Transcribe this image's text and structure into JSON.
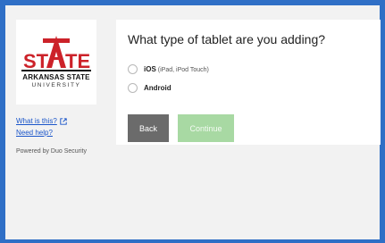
{
  "sidebar": {
    "logo": {
      "mark_text": "STATE",
      "line1": "ARKANSAS STATE",
      "line2": "UNIVERSITY",
      "colors": {
        "red": "#cc2229",
        "black": "#111111"
      }
    },
    "links": [
      {
        "label": "What is this?",
        "icon": "external-link-icon"
      },
      {
        "label": "Need help?"
      }
    ],
    "powered_by": "Powered by Duo Security"
  },
  "panel": {
    "question": "What type of tablet are you adding?",
    "options": [
      {
        "label": "iOS",
        "sublabel": "(iPad, iPod Touch)",
        "selected": false
      },
      {
        "label": "Android",
        "selected": false
      }
    ],
    "buttons": {
      "back": "Back",
      "continue": "Continue",
      "continue_enabled": false
    }
  },
  "colors": {
    "border": "#2f6fc6",
    "link": "#1a55c9",
    "back_button": "#6b6b6b",
    "continue_button_disabled": "#a8d9a3"
  }
}
